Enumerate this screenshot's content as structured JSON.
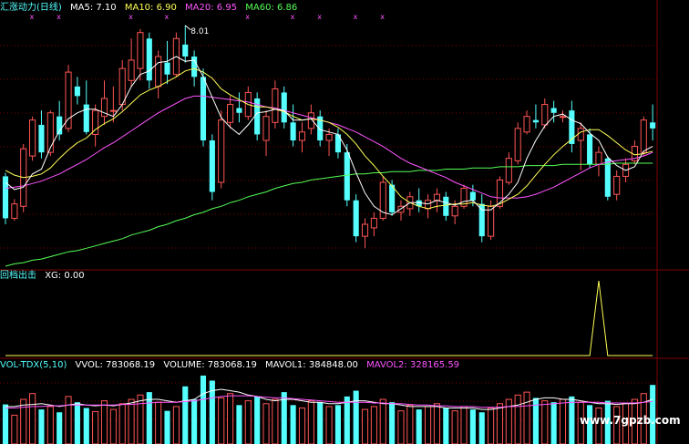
{
  "main_legend": {
    "indicator": "汇涨动力(日线)",
    "ma5": "MA5: 7.10",
    "ma10": "MA10: 6.90",
    "ma20": "MA20: 6.95",
    "ma60": "MA60: 6.86"
  },
  "xg_legend": {
    "indicator": "回档出击",
    "xg": "XG: 0.00"
  },
  "vol_legend": {
    "indicator": "VOL-TDX(5,10)",
    "vvol": "VVOL: 783068.19",
    "volume": "VOLUME: 783068.19",
    "mavol1": "MAVOL1: 384848.00",
    "mavol2": "MAVOL2: 328165.59"
  },
  "high_marker": "8.01",
  "watermark": "www.7gpzb.com",
  "colors": {
    "up": "#ff5555",
    "down": "#55ffff",
    "ma5": "#ffffff",
    "ma10": "#ffff55",
    "ma20": "#ff55ff",
    "ma60": "#55ff55",
    "grid": "#800000",
    "xg": "#ffff55"
  },
  "chart_data": {
    "type": "candlestick",
    "price_range": [
      6.0,
      8.1
    ],
    "candles": [
      [
        6.75,
        6.78,
        6.35,
        6.4
      ],
      [
        6.4,
        6.56,
        6.38,
        6.52
      ],
      [
        6.5,
        7.02,
        6.45,
        6.98
      ],
      [
        6.92,
        7.25,
        6.88,
        7.22
      ],
      [
        7.18,
        7.3,
        6.9,
        6.95
      ],
      [
        6.95,
        7.3,
        6.92,
        7.28
      ],
      [
        7.25,
        7.38,
        7.05,
        7.1
      ],
      [
        7.15,
        7.68,
        7.12,
        7.62
      ],
      [
        7.5,
        7.58,
        7.35,
        7.42
      ],
      [
        7.35,
        7.55,
        7.1,
        7.12
      ],
      [
        7.1,
        7.35,
        7.0,
        7.3
      ],
      [
        7.25,
        7.55,
        7.18,
        7.4
      ],
      [
        7.3,
        7.5,
        7.2,
        7.3
      ],
      [
        7.35,
        7.72,
        7.3,
        7.65
      ],
      [
        7.55,
        7.9,
        7.5,
        7.72
      ],
      [
        7.65,
        7.98,
        7.55,
        7.95
      ],
      [
        7.9,
        7.95,
        7.48,
        7.55
      ],
      [
        7.5,
        7.8,
        7.4,
        7.75
      ],
      [
        7.7,
        7.88,
        7.52,
        7.6
      ],
      [
        7.6,
        7.95,
        7.58,
        7.9
      ],
      [
        7.85,
        8.01,
        7.7,
        7.75
      ],
      [
        7.75,
        7.8,
        7.5,
        7.58
      ],
      [
        7.58,
        7.65,
        7.0,
        7.05
      ],
      [
        7.05,
        7.1,
        6.55,
        6.62
      ],
      [
        6.7,
        7.3,
        6.65,
        7.22
      ],
      [
        7.2,
        7.42,
        7.15,
        7.35
      ],
      [
        7.32,
        7.45,
        7.2,
        7.28
      ],
      [
        7.25,
        7.5,
        7.22,
        7.45
      ],
      [
        7.4,
        7.45,
        7.05,
        7.1
      ],
      [
        7.05,
        7.3,
        6.92,
        7.25
      ],
      [
        7.2,
        7.55,
        7.15,
        7.48
      ],
      [
        7.45,
        7.5,
        7.15,
        7.2
      ],
      [
        7.2,
        7.35,
        7.0,
        7.05
      ],
      [
        7.05,
        7.2,
        6.95,
        7.12
      ],
      [
        7.15,
        7.35,
        7.1,
        7.28
      ],
      [
        7.25,
        7.3,
        7.0,
        7.05
      ],
      [
        7.05,
        7.15,
        6.92,
        7.1
      ],
      [
        7.1,
        7.15,
        6.9,
        6.95
      ],
      [
        6.95,
        7.02,
        6.5,
        6.55
      ],
      [
        6.55,
        6.6,
        6.2,
        6.25
      ],
      [
        6.25,
        6.4,
        6.15,
        6.35
      ],
      [
        6.32,
        6.45,
        6.25,
        6.4
      ],
      [
        6.4,
        6.75,
        6.38,
        6.7
      ],
      [
        6.68,
        6.72,
        6.42,
        6.45
      ],
      [
        6.45,
        6.55,
        6.38,
        6.5
      ],
      [
        6.48,
        6.62,
        6.42,
        6.58
      ],
      [
        6.55,
        6.65,
        6.45,
        6.5
      ],
      [
        6.48,
        6.6,
        6.4,
        6.55
      ],
      [
        6.55,
        6.65,
        6.45,
        6.6
      ],
      [
        6.58,
        6.62,
        6.38,
        6.42
      ],
      [
        6.42,
        6.55,
        6.35,
        6.5
      ],
      [
        6.5,
        6.68,
        6.48,
        6.65
      ],
      [
        6.62,
        6.68,
        6.5,
        6.55
      ],
      [
        6.52,
        6.6,
        6.2,
        6.25
      ],
      [
        6.25,
        6.55,
        6.22,
        6.5
      ],
      [
        6.5,
        6.75,
        6.48,
        6.72
      ],
      [
        6.7,
        6.95,
        6.68,
        6.9
      ],
      [
        6.88,
        7.2,
        6.85,
        7.15
      ],
      [
        7.12,
        7.3,
        7.1,
        7.25
      ],
      [
        7.22,
        7.35,
        7.15,
        7.2
      ],
      [
        7.18,
        7.4,
        7.15,
        7.35
      ],
      [
        7.32,
        7.38,
        7.2,
        7.28
      ],
      [
        7.25,
        7.3,
        7.2,
        7.25
      ],
      [
        7.3,
        7.38,
        6.95,
        7.02
      ],
      [
        7.05,
        7.2,
        6.8,
        7.15
      ],
      [
        7.1,
        7.15,
        6.82,
        6.85
      ],
      [
        6.85,
        7.0,
        6.75,
        6.95
      ],
      [
        6.9,
        6.92,
        6.55,
        6.58
      ],
      [
        6.6,
        6.8,
        6.55,
        6.75
      ],
      [
        6.75,
        6.9,
        6.7,
        6.85
      ],
      [
        6.88,
        7.05,
        6.85,
        7.0
      ],
      [
        6.95,
        7.25,
        6.92,
        7.22
      ],
      [
        7.2,
        7.35,
        7.05,
        7.15
      ]
    ],
    "ma5": [
      6.7,
      6.64,
      6.66,
      6.77,
      6.81,
      6.99,
      7.13,
      7.23,
      7.28,
      7.31,
      7.31,
      7.28,
      7.25,
      7.35,
      7.5,
      7.6,
      7.63,
      7.7,
      7.71,
      7.75,
      7.71,
      7.72,
      7.58,
      7.41,
      7.24,
      7.16,
      7.1,
      7.18,
      7.28,
      7.29,
      7.31,
      7.3,
      7.22,
      7.22,
      7.23,
      7.14,
      7.12,
      7.1,
      6.97,
      6.78,
      6.61,
      6.5,
      6.45,
      6.43,
      6.48,
      6.53,
      6.53,
      6.52,
      6.55,
      6.53,
      6.51,
      6.54,
      6.55,
      6.47,
      6.47,
      6.53,
      6.6,
      6.7,
      6.9,
      7.05,
      7.17,
      7.25,
      7.27,
      7.22,
      7.19,
      7.11,
      7.05,
      6.91,
      6.84,
      6.8,
      6.83,
      6.96,
      7.0
    ],
    "ma10": [
      6.8,
      6.76,
      6.74,
      6.75,
      6.77,
      6.82,
      6.9,
      6.97,
      7.03,
      7.07,
      7.14,
      7.19,
      7.23,
      7.29,
      7.36,
      7.43,
      7.47,
      7.5,
      7.54,
      7.58,
      7.63,
      7.65,
      7.62,
      7.57,
      7.48,
      7.43,
      7.39,
      7.35,
      7.33,
      7.33,
      7.31,
      7.29,
      7.25,
      7.22,
      7.23,
      7.22,
      7.2,
      7.16,
      7.1,
      7.02,
      6.92,
      6.84,
      6.75,
      6.67,
      6.58,
      6.53,
      6.5,
      6.48,
      6.5,
      6.51,
      6.52,
      6.52,
      6.53,
      6.51,
      6.5,
      6.52,
      6.56,
      6.6,
      6.67,
      6.76,
      6.85,
      6.93,
      7.0,
      7.06,
      7.12,
      7.14,
      7.14,
      7.09,
      7.03,
      6.97,
      6.93,
      6.94,
      6.96
    ],
    "ma20": [
      6.65,
      6.66,
      6.67,
      6.69,
      6.71,
      6.74,
      6.77,
      6.81,
      6.85,
      6.89,
      6.94,
      6.99,
      7.03,
      7.08,
      7.13,
      7.18,
      7.23,
      7.28,
      7.32,
      7.36,
      7.4,
      7.42,
      7.42,
      7.41,
      7.4,
      7.39,
      7.38,
      7.37,
      7.35,
      7.33,
      7.32,
      7.3,
      7.28,
      7.26,
      7.24,
      7.22,
      7.2,
      7.18,
      7.15,
      7.12,
      7.08,
      7.04,
      7.0,
      6.95,
      6.9,
      6.86,
      6.83,
      6.8,
      6.77,
      6.74,
      6.7,
      6.67,
      6.64,
      6.61,
      6.58,
      6.57,
      6.57,
      6.57,
      6.58,
      6.6,
      6.63,
      6.66,
      6.7,
      6.74,
      6.78,
      6.82,
      6.85,
      6.87,
      6.88,
      6.89,
      6.9,
      6.92,
      6.95
    ],
    "ma60": [
      6.0,
      6.02,
      6.03,
      6.05,
      6.06,
      6.08,
      6.1,
      6.12,
      6.13,
      6.15,
      6.17,
      6.19,
      6.21,
      6.23,
      6.26,
      6.28,
      6.3,
      6.33,
      6.35,
      6.38,
      6.4,
      6.43,
      6.45,
      6.48,
      6.5,
      6.53,
      6.55,
      6.58,
      6.6,
      6.62,
      6.65,
      6.67,
      6.69,
      6.7,
      6.72,
      6.73,
      6.74,
      6.75,
      6.76,
      6.77,
      6.77,
      6.78,
      6.78,
      6.79,
      6.79,
      6.79,
      6.8,
      6.8,
      6.8,
      6.81,
      6.81,
      6.81,
      6.82,
      6.82,
      6.82,
      6.83,
      6.83,
      6.83,
      6.84,
      6.84,
      6.84,
      6.84,
      6.85,
      6.85,
      6.85,
      6.85,
      6.85,
      6.85,
      6.86,
      6.86,
      6.86,
      6.86,
      6.86
    ],
    "xg_values": [
      0,
      0,
      0,
      0,
      0,
      0,
      0,
      0,
      0,
      0,
      0,
      0,
      0,
      0,
      0,
      0,
      0,
      0,
      0,
      0,
      0,
      0,
      0,
      0,
      0,
      0,
      0,
      0,
      0,
      0,
      0,
      0,
      0,
      0,
      0,
      0,
      0,
      0,
      0,
      0,
      0,
      0,
      0,
      0,
      0,
      0,
      0,
      0,
      0,
      0,
      0,
      0,
      0,
      0,
      0,
      0,
      0,
      0,
      0,
      0,
      0,
      0,
      0,
      0,
      0,
      0,
      1,
      0,
      0,
      0,
      0,
      0,
      0
    ],
    "volume": [
      55,
      40,
      62,
      70,
      48,
      52,
      44,
      66,
      58,
      50,
      45,
      60,
      48,
      56,
      62,
      68,
      72,
      58,
      46,
      52,
      80,
      62,
      95,
      88,
      64,
      70,
      54,
      60,
      66,
      56,
      62,
      72,
      54,
      50,
      60,
      58,
      52,
      54,
      66,
      74,
      48,
      52,
      62,
      58,
      46,
      54,
      48,
      52,
      56,
      50,
      46,
      52,
      48,
      44,
      50,
      56,
      62,
      68,
      72,
      64,
      60,
      58,
      62,
      66,
      58,
      54,
      50,
      60,
      52,
      56,
      62,
      70,
      82
    ],
    "vol_scale_max": 100,
    "mavol1": [
      52,
      52,
      54,
      55,
      56,
      54,
      52,
      54,
      56,
      54,
      53,
      54,
      53,
      55,
      57,
      60,
      62,
      62,
      60,
      58,
      60,
      62,
      70,
      74,
      76,
      74,
      72,
      68,
      66,
      62,
      60,
      62,
      62,
      60,
      58,
      58,
      56,
      56,
      58,
      60,
      60,
      58,
      56,
      56,
      54,
      52,
      52,
      52,
      52,
      50,
      50,
      50,
      50,
      48,
      48,
      50,
      52,
      54,
      58,
      62,
      64,
      64,
      62,
      62,
      60,
      58,
      56,
      56,
      55,
      56,
      56,
      58,
      62
    ],
    "mavol2": [
      50,
      50,
      51,
      52,
      52,
      53,
      53,
      54,
      54,
      54,
      54,
      54,
      54,
      55,
      55,
      56,
      57,
      58,
      58,
      58,
      59,
      60,
      62,
      64,
      66,
      67,
      67,
      67,
      66,
      65,
      64,
      64,
      63,
      62,
      61,
      60,
      59,
      58,
      58,
      58,
      58,
      57,
      57,
      56,
      56,
      55,
      54,
      54,
      53,
      53,
      52,
      52,
      52,
      51,
      51,
      51,
      52,
      52,
      53,
      54,
      55,
      56,
      57,
      58,
      58,
      58,
      58,
      57,
      57,
      57,
      57,
      58,
      59
    ],
    "top_markers": [
      "x",
      "x",
      "x",
      "x",
      "x",
      "x",
      "x",
      "x",
      "x"
    ]
  }
}
